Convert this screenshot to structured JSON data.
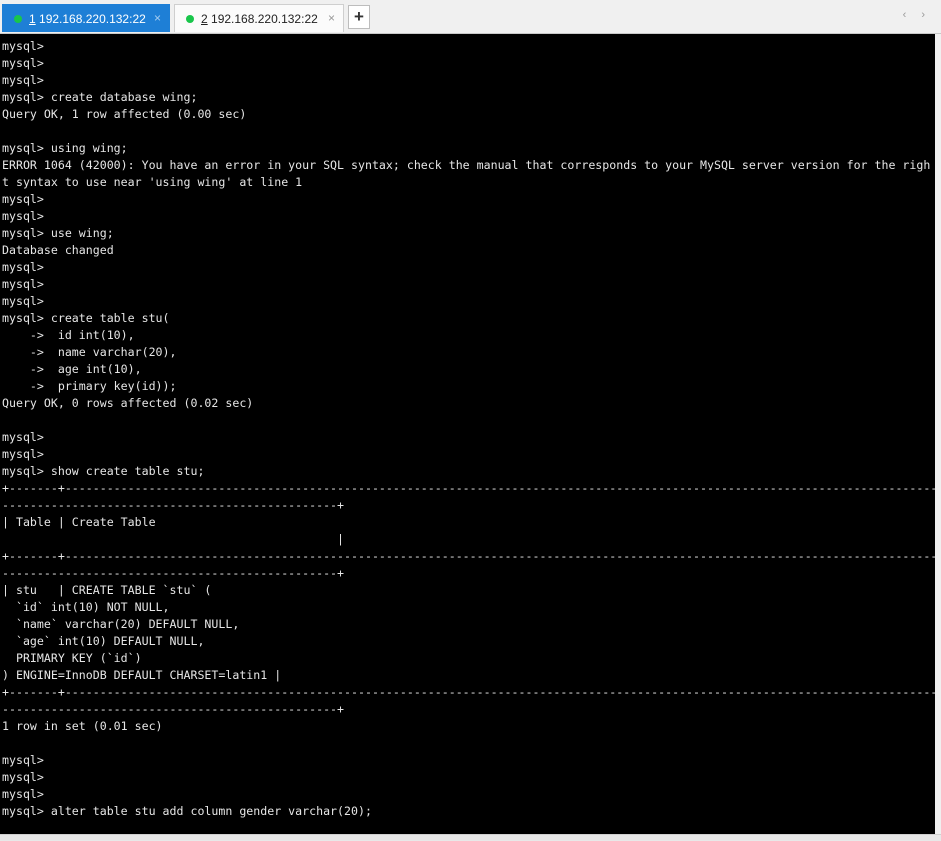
{
  "tabs": [
    {
      "index": "1",
      "label": " 192.168.220.132:22",
      "status": "connected",
      "status_color": "#19c64b",
      "active": true,
      "close_icon": "×"
    },
    {
      "index": "2",
      "label": " 192.168.220.132:22",
      "status": "connected",
      "status_color": "#19c64b",
      "active": false,
      "close_icon": "×"
    }
  ],
  "new_tab_label": "+",
  "nav_arrows": "‹ ›",
  "terminal": {
    "lines": [
      "mysql>",
      "mysql>",
      "mysql>",
      "mysql> create database wing;",
      "Query OK, 1 row affected (0.00 sec)",
      "",
      "mysql> using wing;",
      "ERROR 1064 (42000): You have an error in your SQL syntax; check the manual that corresponds to your MySQL server version for the righ",
      "t syntax to use near 'using wing' at line 1",
      "mysql>",
      "mysql>",
      "mysql> use wing;",
      "Database changed",
      "mysql>",
      "mysql>",
      "mysql>",
      "mysql> create table stu(",
      "    ->  id int(10),",
      "    ->  name varchar(20),",
      "    ->  age int(10),",
      "    ->  primary key(id));",
      "Query OK, 0 rows affected (0.02 sec)",
      "",
      "mysql>",
      "mysql>",
      "mysql> show create table stu;",
      "+-------+-----------------------------------------------------------------------------------------------------------------------------",
      "------------------------------------------------+",
      "| Table | Create Table",
      "                                                |",
      "+-------+-----------------------------------------------------------------------------------------------------------------------------",
      "------------------------------------------------+",
      "| stu   | CREATE TABLE `stu` (",
      "  `id` int(10) NOT NULL,",
      "  `name` varchar(20) DEFAULT NULL,",
      "  `age` int(10) DEFAULT NULL,",
      "  PRIMARY KEY (`id`)",
      ") ENGINE=InnoDB DEFAULT CHARSET=latin1 |",
      "+-------+-----------------------------------------------------------------------------------------------------------------------------",
      "------------------------------------------------+",
      "1 row in set (0.01 sec)",
      "",
      "mysql>",
      "mysql>",
      "mysql>",
      "mysql> alter table stu add column gender varchar(20);"
    ]
  }
}
